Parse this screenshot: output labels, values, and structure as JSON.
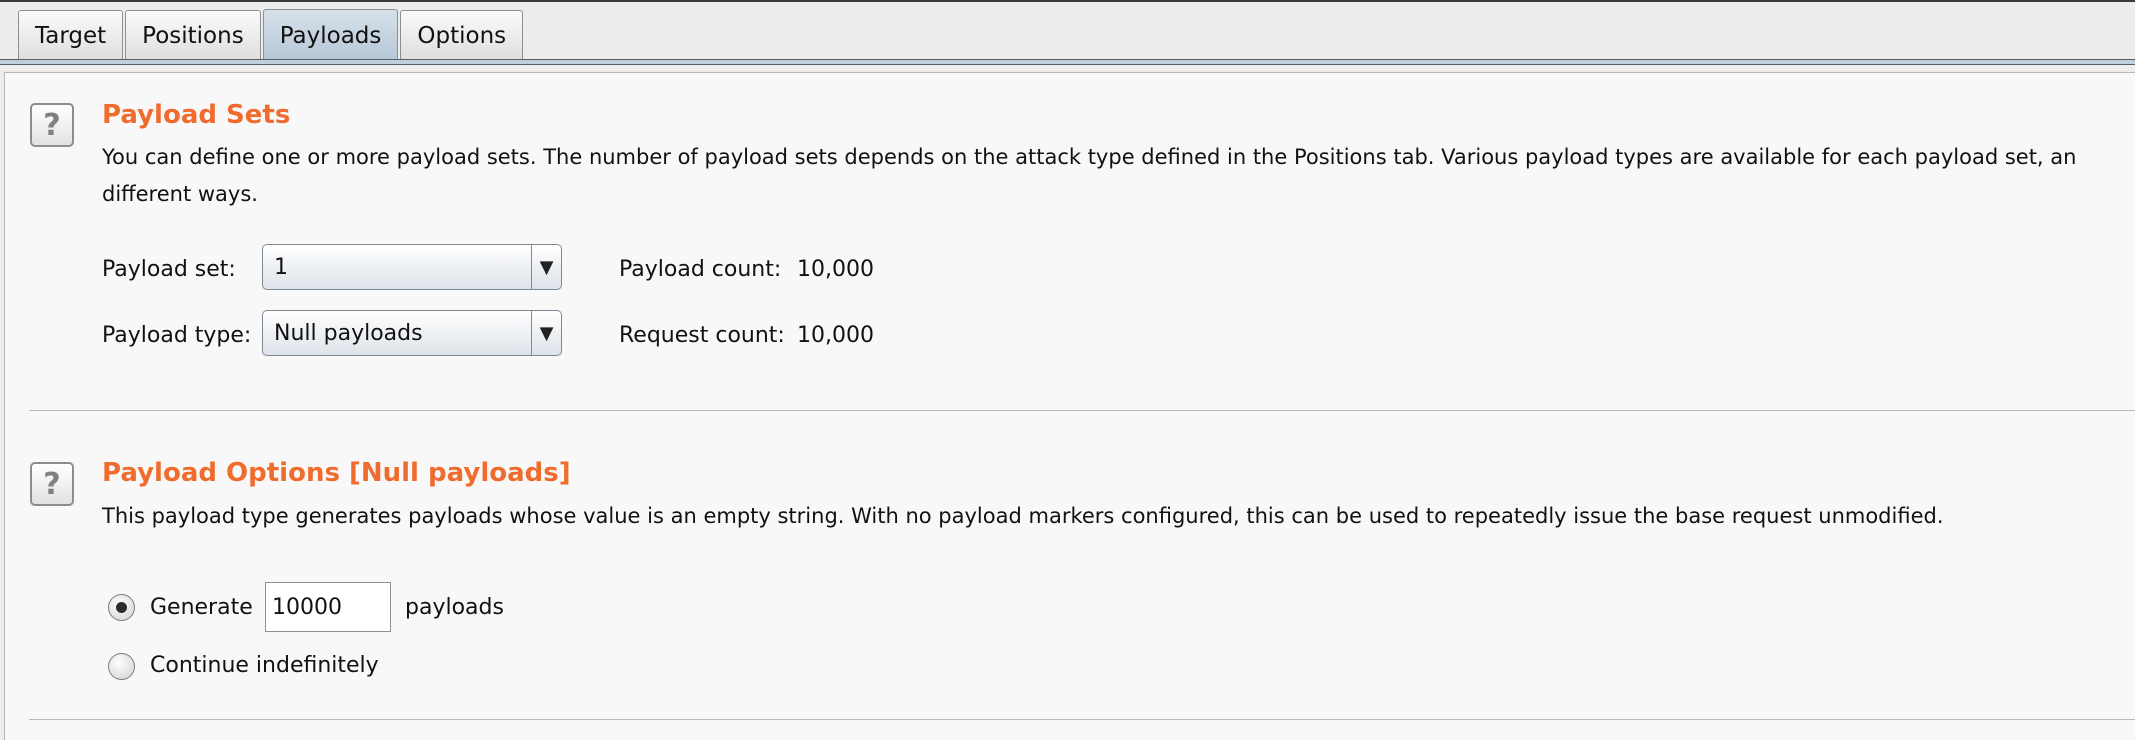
{
  "tabs": [
    {
      "label": "Target"
    },
    {
      "label": "Positions"
    },
    {
      "label": "Payloads",
      "active": true
    },
    {
      "label": "Options"
    }
  ],
  "payload_sets": {
    "title": "Payload Sets",
    "description": "You can define one or more payload sets. The number of payload sets depends on the attack type defined in the Positions tab. Various payload types are available for each payload set, an",
    "description_line2": "different ways.",
    "payload_set_label": "Payload set:",
    "payload_set_value": "1",
    "payload_type_label": "Payload type:",
    "payload_type_value": "Null payloads",
    "payload_count_label": "Payload count:",
    "payload_count_value": "10,000",
    "request_count_label": "Request count:",
    "request_count_value": "10,000"
  },
  "payload_options": {
    "title": "Payload Options [Null payloads]",
    "description": "This payload type generates payloads whose value is an empty string. With no payload markers configured, this can be used to repeatedly issue the base request unmodified.",
    "generate_label": "Generate",
    "generate_value": "10000",
    "payloads_suffix": "payloads",
    "continue_label": "Continue indefinitely",
    "selected_option": "Generate"
  },
  "colors": {
    "accent_title": "#f06c2e",
    "active_tab": "#b5c6d6",
    "panel_bg": "#f8f8f8"
  },
  "icons": {
    "help": "question-mark-icon",
    "dropdown": "triangle-down-icon"
  },
  "help_glyph": "?",
  "dropdown_glyph": "▼"
}
